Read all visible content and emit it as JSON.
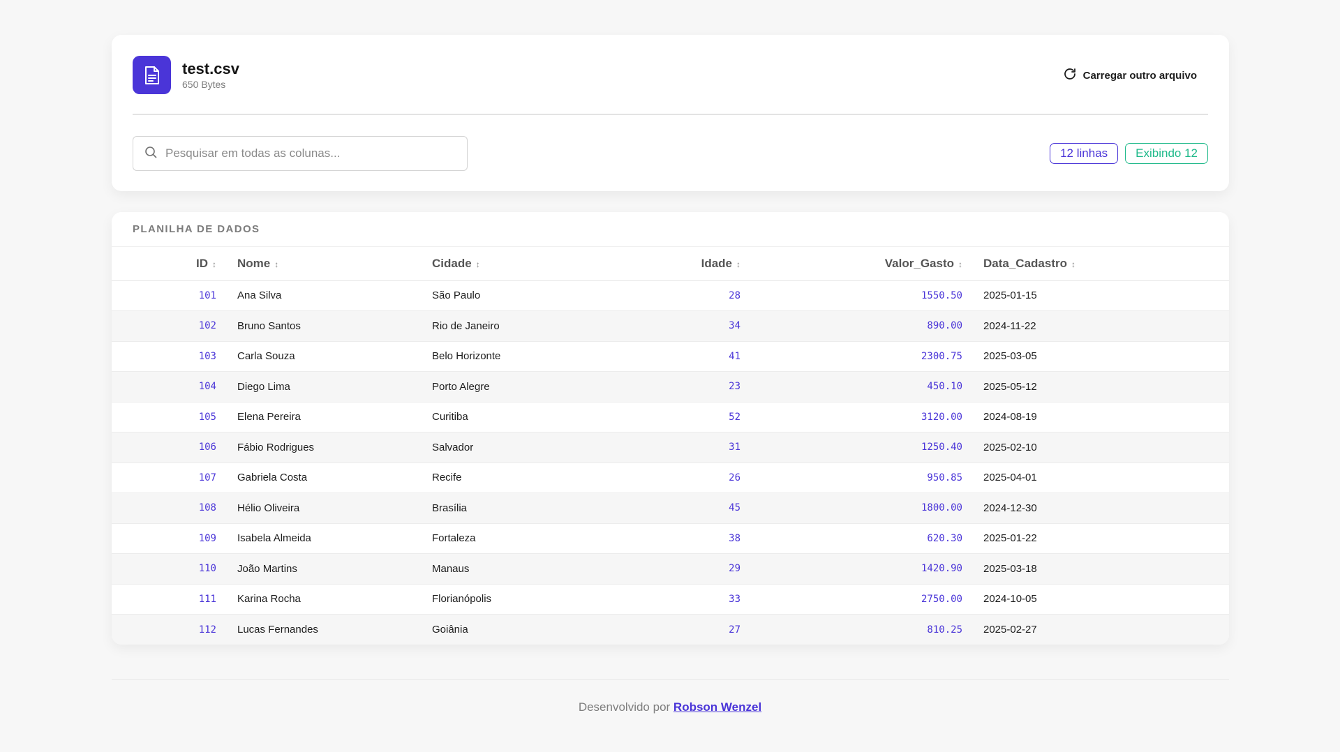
{
  "file": {
    "name": "test.csv",
    "size": "650 Bytes",
    "icon": "file-text-icon"
  },
  "actions": {
    "reload_label": "Carregar outro arquivo",
    "reload_icon": "refresh-icon"
  },
  "search": {
    "placeholder": "Pesquisar em todas as colunas...",
    "value": ""
  },
  "badges": {
    "rows": "12 linhas",
    "showing": "Exibindo 12"
  },
  "table": {
    "title": "PLANILHA DE DADOS",
    "columns": [
      "ID",
      "Nome",
      "Cidade",
      "Idade",
      "Valor_Gasto",
      "Data_Cadastro"
    ],
    "sort_glyph": "↕",
    "rows": [
      [
        "101",
        "Ana Silva",
        "São Paulo",
        "28",
        "1550.50",
        "2025-01-15"
      ],
      [
        "102",
        "Bruno Santos",
        "Rio de Janeiro",
        "34",
        "890.00",
        "2024-11-22"
      ],
      [
        "103",
        "Carla Souza",
        "Belo Horizonte",
        "41",
        "2300.75",
        "2025-03-05"
      ],
      [
        "104",
        "Diego Lima",
        "Porto Alegre",
        "23",
        "450.10",
        "2025-05-12"
      ],
      [
        "105",
        "Elena Pereira",
        "Curitiba",
        "52",
        "3120.00",
        "2024-08-19"
      ],
      [
        "106",
        "Fábio Rodrigues",
        "Salvador",
        "31",
        "1250.40",
        "2025-02-10"
      ],
      [
        "107",
        "Gabriela Costa",
        "Recife",
        "26",
        "950.85",
        "2025-04-01"
      ],
      [
        "108",
        "Hélio Oliveira",
        "Brasília",
        "45",
        "1800.00",
        "2024-12-30"
      ],
      [
        "109",
        "Isabela Almeida",
        "Fortaleza",
        "38",
        "620.30",
        "2025-01-22"
      ],
      [
        "110",
        "João Martins",
        "Manaus",
        "29",
        "1420.90",
        "2025-03-18"
      ],
      [
        "111",
        "Karina Rocha",
        "Florianópolis",
        "33",
        "2750.00",
        "2024-10-05"
      ],
      [
        "112",
        "Lucas Fernandes",
        "Goiânia",
        "27",
        "810.25",
        "2025-02-27"
      ]
    ]
  },
  "footer": {
    "prefix": "Desenvolvido por",
    "author": "Robson Wenzel"
  },
  "colors": {
    "accent": "#4a35d8",
    "success": "#1fb98a",
    "background": "#f7f7f7"
  }
}
